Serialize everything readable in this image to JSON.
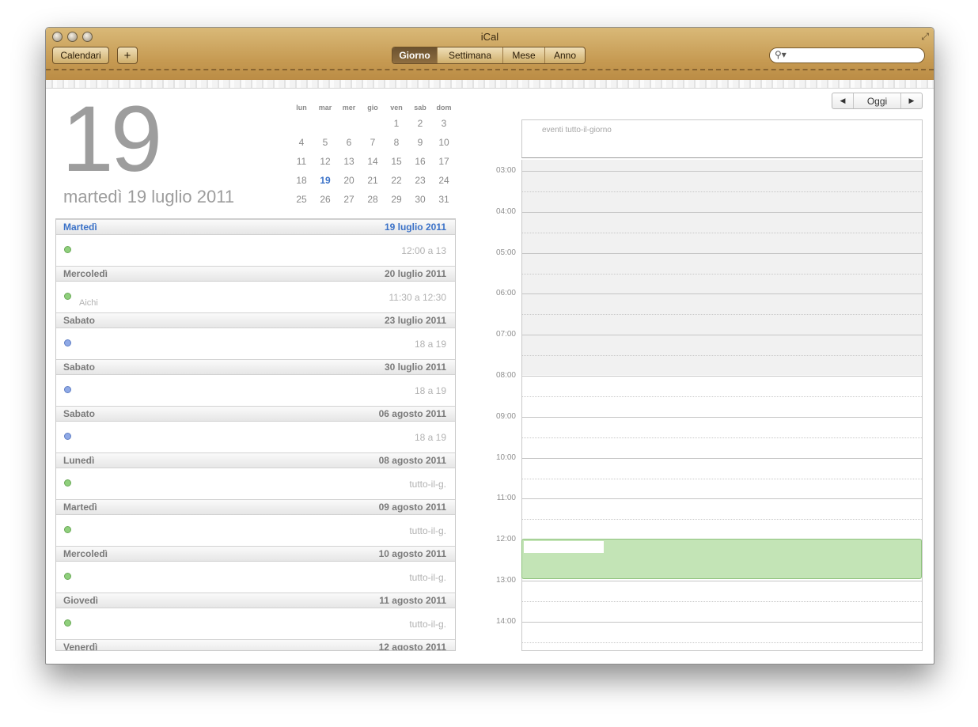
{
  "window": {
    "title": "iCal"
  },
  "toolbar": {
    "calendars_label": "Calendari",
    "add_label": "+",
    "views": [
      {
        "label": "Giorno",
        "active": true
      },
      {
        "label": "Settimana",
        "active": false
      },
      {
        "label": "Mese",
        "active": false
      },
      {
        "label": "Anno",
        "active": false
      }
    ],
    "search": {
      "icon": "search-icon",
      "value": "",
      "placeholder": ""
    }
  },
  "header": {
    "big_day": "19",
    "full_date": "martedì 19 luglio 2011"
  },
  "mini_calendar": {
    "weekdays": [
      "lun",
      "mar",
      "mer",
      "gio",
      "ven",
      "sab",
      "dom"
    ],
    "weeks": [
      [
        "",
        "",
        "",
        "",
        "1",
        "2",
        "3"
      ],
      [
        "4",
        "5",
        "6",
        "7",
        "8",
        "9",
        "10"
      ],
      [
        "11",
        "12",
        "13",
        "14",
        "15",
        "16",
        "17"
      ],
      [
        "18",
        "19",
        "20",
        "21",
        "22",
        "23",
        "24"
      ],
      [
        "25",
        "26",
        "27",
        "28",
        "29",
        "30",
        "31"
      ]
    ],
    "today": "19"
  },
  "event_list": [
    {
      "day": "Martedì",
      "date": "19 luglio 2011",
      "current": true,
      "color": "green",
      "time": "12:00 a 13",
      "location": ""
    },
    {
      "day": "Mercoledì",
      "date": "20 luglio 2011",
      "current": false,
      "color": "green",
      "time": "11:30 a 12:30",
      "location": "Aichi"
    },
    {
      "day": "Sabato",
      "date": "23 luglio 2011",
      "current": false,
      "color": "blue",
      "time": "18 a 19",
      "location": ""
    },
    {
      "day": "Sabato",
      "date": "30 luglio 2011",
      "current": false,
      "color": "blue",
      "time": "18 a 19",
      "location": ""
    },
    {
      "day": "Sabato",
      "date": "06 agosto 2011",
      "current": false,
      "color": "blue",
      "time": "18 a 19",
      "location": ""
    },
    {
      "day": "Lunedì",
      "date": "08 agosto 2011",
      "current": false,
      "color": "green",
      "time": "tutto-il-g.",
      "location": ""
    },
    {
      "day": "Martedì",
      "date": "09 agosto 2011",
      "current": false,
      "color": "green",
      "time": "tutto-il-g.",
      "location": ""
    },
    {
      "day": "Mercoledì",
      "date": "10 agosto 2011",
      "current": false,
      "color": "green",
      "time": "tutto-il-g.",
      "location": ""
    },
    {
      "day": "Giovedì",
      "date": "11 agosto 2011",
      "current": false,
      "color": "green",
      "time": "tutto-il-g.",
      "location": ""
    },
    {
      "day": "Venerdì",
      "date": "12 agosto 2011",
      "current": false,
      "color": "green",
      "time": "",
      "location": ""
    }
  ],
  "day_view": {
    "nav": {
      "prev": "◀",
      "today": "Oggi",
      "next": "▶"
    },
    "all_day_label": "eventi tutto-il-giorno",
    "hours": [
      "03:00",
      "04:00",
      "05:00",
      "06:00",
      "07:00",
      "08:00",
      "09:00",
      "10:00",
      "11:00",
      "12:00",
      "13:00",
      "14:00"
    ],
    "event": {
      "start": "12:00",
      "end": "13:00",
      "color": "#c3e4b6"
    }
  },
  "colors": {
    "accent_blue": "#3b72c8",
    "green_dot": "#8fcf7c",
    "blue_dot": "#8fa9e6",
    "leather": "#c69a52"
  }
}
